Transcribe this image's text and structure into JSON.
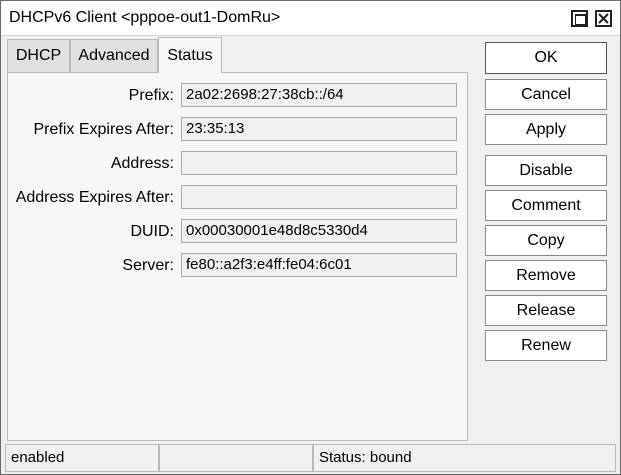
{
  "window": {
    "title": "DHCPv6 Client <pppoe-out1-DomRu>"
  },
  "tabs": [
    {
      "label": "DHCP"
    },
    {
      "label": "Advanced"
    },
    {
      "label": "Status"
    }
  ],
  "active_tab": "Status",
  "fields": {
    "prefix": {
      "label": "Prefix:",
      "value": "2a02:2698:27:38cb::/64"
    },
    "prefix_expires": {
      "label": "Prefix Expires After:",
      "value": "23:35:13"
    },
    "address": {
      "label": "Address:",
      "value": ""
    },
    "address_expires": {
      "label": "Address Expires After:",
      "value": ""
    },
    "duid": {
      "label": "DUID:",
      "value": "0x00030001e48d8c5330d4"
    },
    "server": {
      "label": "Server:",
      "value": "fe80::a2f3:e4ff:fe04:6c01"
    }
  },
  "buttons": {
    "ok": "OK",
    "cancel": "Cancel",
    "apply": "Apply",
    "disable": "Disable",
    "comment": "Comment",
    "copy": "Copy",
    "remove": "Remove",
    "release": "Release",
    "renew": "Renew"
  },
  "statusbar": {
    "state": "enabled",
    "middle": "",
    "status": "Status: bound"
  }
}
